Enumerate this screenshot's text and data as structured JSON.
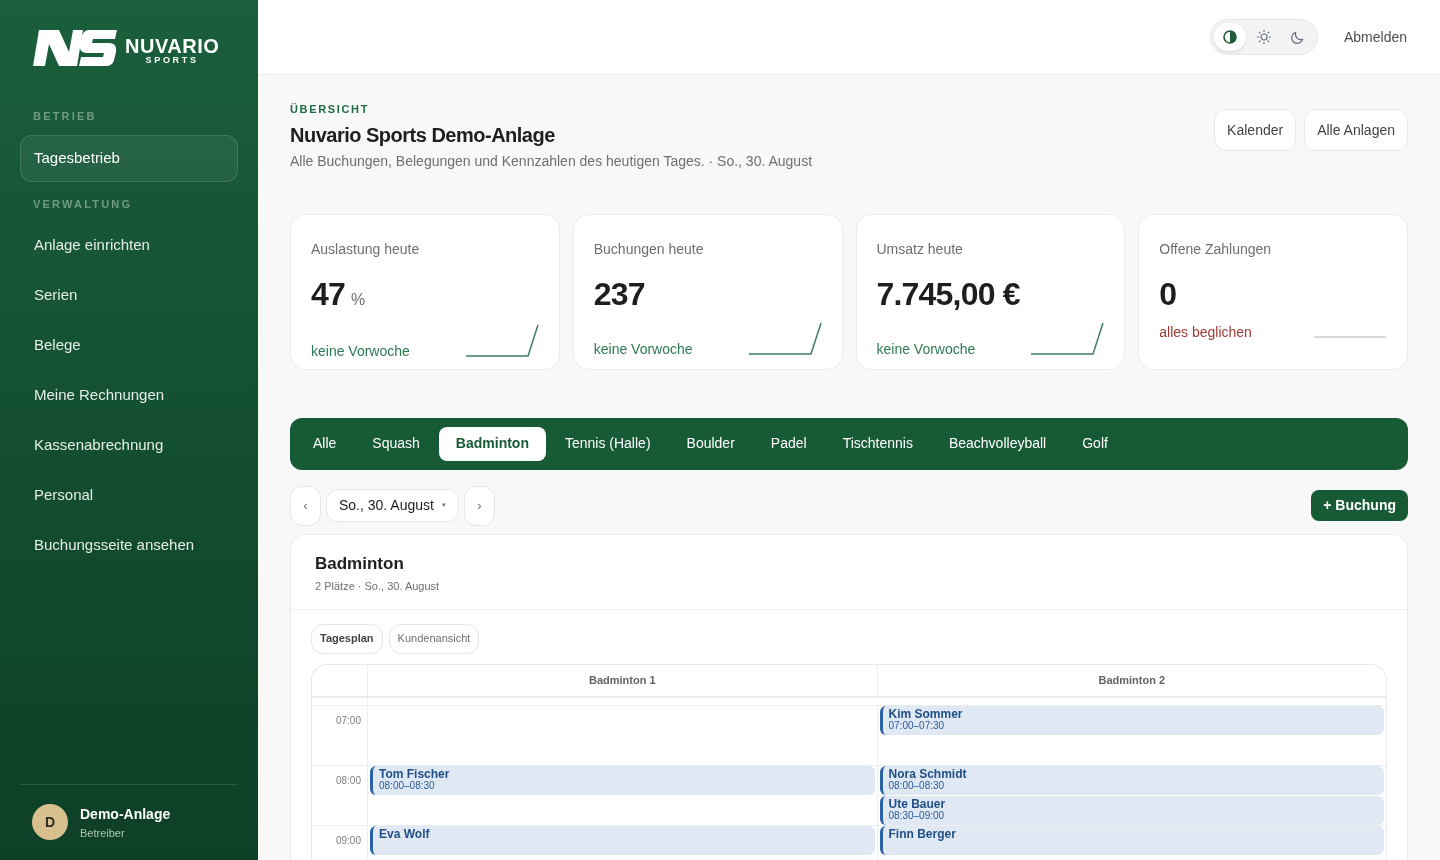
{
  "brand": {
    "name": "NUVARIO",
    "tagline": "SPORTS"
  },
  "sidebar": {
    "sections": [
      {
        "title": "BETRIEB",
        "items": [
          {
            "label": "Tagesbetrieb",
            "selected": true
          }
        ]
      },
      {
        "title": "VERWALTUNG",
        "items": [
          {
            "label": "Anlage einrichten",
            "selected": false
          },
          {
            "label": "Serien",
            "selected": false
          },
          {
            "label": "Belege",
            "selected": false
          },
          {
            "label": "Meine Rechnungen",
            "selected": false
          },
          {
            "label": "Kassenabrechnung",
            "selected": false
          },
          {
            "label": "Personal",
            "selected": false
          },
          {
            "label": "Buchungsseite ansehen",
            "selected": false
          }
        ]
      }
    ],
    "user": {
      "initial": "D",
      "name": "Demo-Anlage",
      "role": "Betreiber"
    }
  },
  "header": {
    "theme_modes": [
      {
        "kind": "auto",
        "selected": true
      },
      {
        "kind": "light",
        "selected": false
      },
      {
        "kind": "dark",
        "selected": false
      }
    ],
    "logout": "Abmelden"
  },
  "page": {
    "eyebrow": "ÜBERSICHT",
    "title": "Nuvario Sports Demo-Anlage",
    "subtitle": "Alle Buchungen, Belegungen und Kennzahlen des heutigen Tages. · So., 30. August",
    "actions": [
      "Kalender",
      "Alle Anlagen"
    ]
  },
  "stats": [
    {
      "label": "Auslastung heute",
      "value": "47",
      "unit": "%",
      "note": "keine Vorwoche",
      "alert": false,
      "kind": "rising"
    },
    {
      "label": "Buchungen heute",
      "value": "237",
      "note": "keine Vorwoche",
      "alert": false,
      "kind": "rising"
    },
    {
      "label": "Umsatz heute",
      "value": "7.745,00 €",
      "note": "keine Vorwoche",
      "alert": false,
      "kind": "rising"
    },
    {
      "label": "Offene Zahlungen",
      "value": "0",
      "note": "alles beglichen",
      "alert": true,
      "kind": "flat"
    }
  ],
  "sport_tabs": [
    {
      "label": "Alle",
      "selected": false
    },
    {
      "label": "Squash",
      "selected": false
    },
    {
      "label": "Badminton",
      "selected": true
    },
    {
      "label": "Tennis (Halle)",
      "selected": false
    },
    {
      "label": "Boulder",
      "selected": false
    },
    {
      "label": "Padel",
      "selected": false
    },
    {
      "label": "Tischtennis",
      "selected": false
    },
    {
      "label": "Beachvolleyball",
      "selected": false
    },
    {
      "label": "Golf",
      "selected": false
    }
  ],
  "date_nav": {
    "prev": "‹",
    "date": "So., 30. August",
    "caret": "▾",
    "next": "›"
  },
  "new_booking": "+ Buchung",
  "schedule": {
    "title": "Badminton",
    "subtitle": "2 Plätze · So., 30. August",
    "views": [
      {
        "label": "Tagesplan",
        "selected": true
      },
      {
        "label": "Kundenansicht",
        "selected": false
      }
    ],
    "courts": [
      "Badminton 1",
      "Badminton 2"
    ],
    "hours": [
      {
        "label": "07:00",
        "cells": [
          [],
          [
            {
              "name": "Kim Sommer",
              "time": "07:00–07:30",
              "kind": "early"
            }
          ]
        ]
      },
      {
        "label": "08:00",
        "cells": [
          [
            {
              "name": "Tom Fischer",
              "time": "08:00–08:30",
              "kind": "early"
            }
          ],
          [
            {
              "name": "Nora Schmidt",
              "time": "08:00–08:30",
              "kind": "early"
            },
            {
              "name": "Ute Bauer",
              "time": "08:30–09:00",
              "kind": "late"
            }
          ]
        ]
      },
      {
        "label": "09:00",
        "cells": [
          [
            {
              "name": "Eva Wolf",
              "kind": "early"
            }
          ],
          [
            {
              "name": "Finn Berger",
              "kind": "early"
            }
          ]
        ]
      }
    ]
  }
}
